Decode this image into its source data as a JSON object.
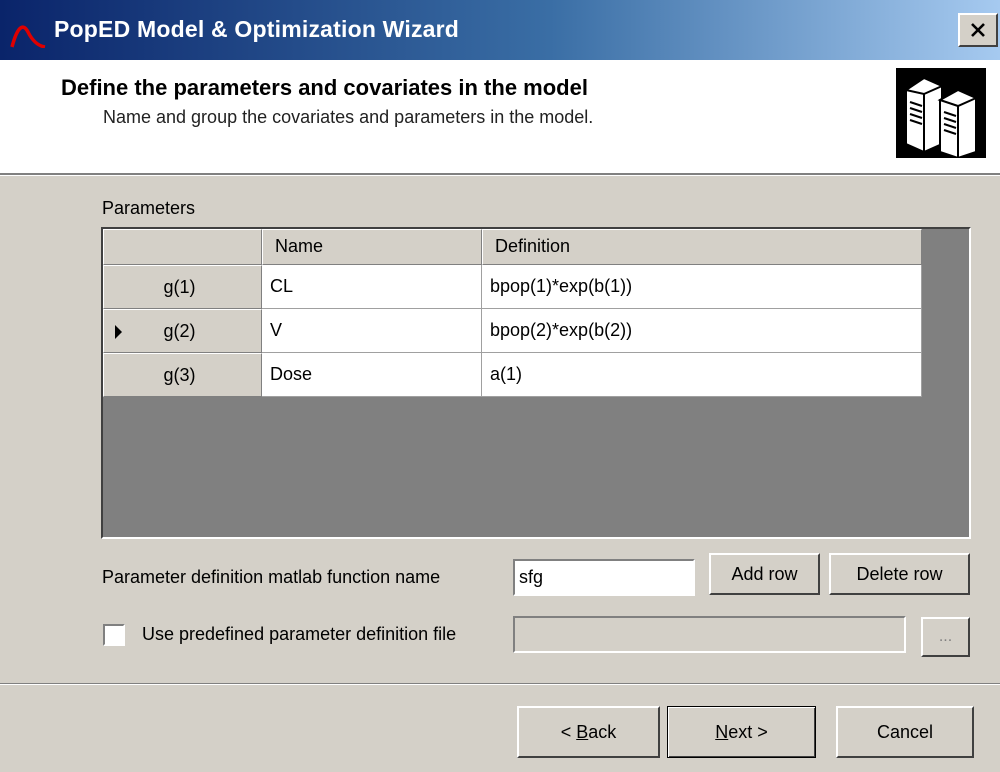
{
  "window": {
    "title": "PopED Model & Optimization Wizard",
    "close_symbol": "×"
  },
  "header": {
    "title": "Define the parameters and covariates in the model",
    "subtitle": "Name and group the covariates and parameters in the model.",
    "logo_icon": "server-computers-icon"
  },
  "parameters": {
    "group_label": "Parameters",
    "columns": [
      "",
      "Name",
      "Definition"
    ],
    "rows": [
      {
        "id": "g(1)",
        "name": "CL",
        "definition": "bpop(1)*exp(b(1))",
        "current": false
      },
      {
        "id": "g(2)",
        "name": "V",
        "definition": "bpop(2)*exp(b(2))",
        "current": true
      },
      {
        "id": "g(3)",
        "name": "Dose",
        "definition": "a(1)",
        "current": false
      }
    ]
  },
  "function_name": {
    "label": "Parameter definition matlab function name",
    "value": "sfg"
  },
  "buttons": {
    "add_row": "Add row",
    "delete_row": "Delete row",
    "browse": "...",
    "back_mnemonic": "B",
    "back_rest": "ack",
    "back_prefix": "< ",
    "next_mnemonic": "N",
    "next_rest": "ext >",
    "cancel": "Cancel"
  },
  "predefined_file": {
    "label": "Use predefined parameter definition file",
    "checked": false,
    "value": ""
  },
  "colors": {
    "titlebar_start": "#0a246a",
    "titlebar_end": "#a6caf0",
    "dialog_bg": "#d4d0c8",
    "grid_bg": "#808080"
  }
}
